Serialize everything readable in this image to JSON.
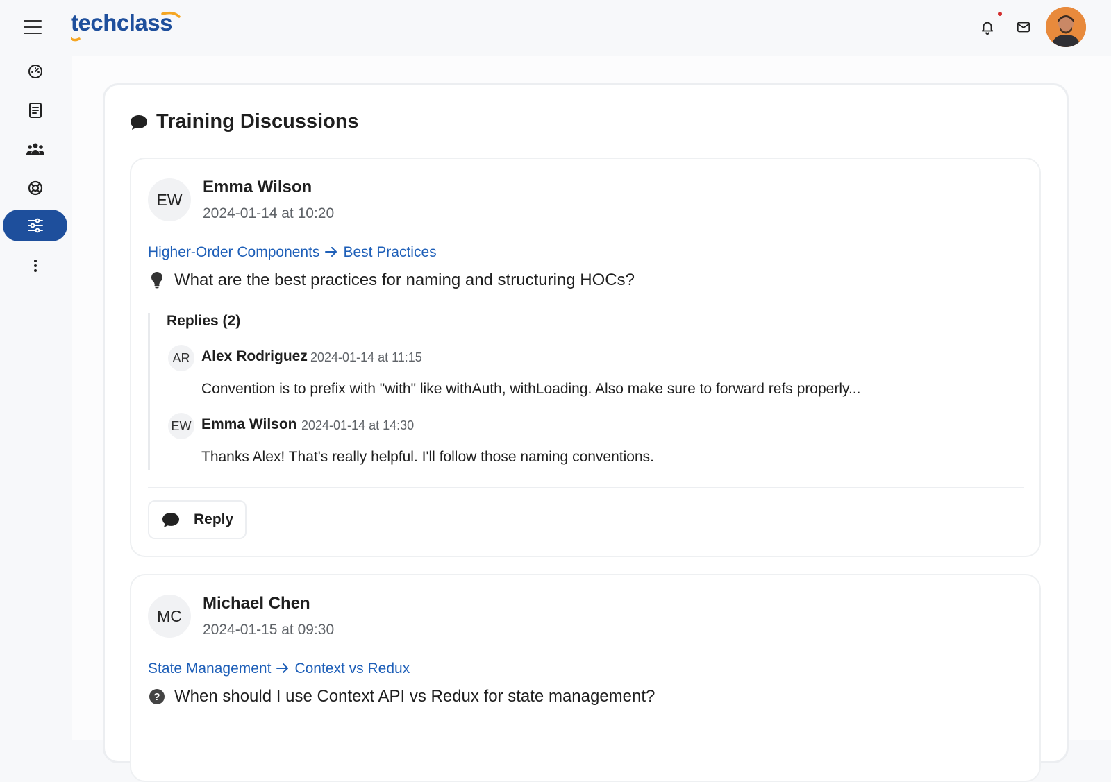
{
  "app": {
    "logo_text": "techclass"
  },
  "header": {
    "menu_icon": "hamburger-icon",
    "notification_icon": "bell-icon",
    "mail_icon": "mail-icon",
    "has_unread_notifications": true,
    "accent": "#1e4f9c",
    "logo_swoosh_color": "#f5a623"
  },
  "sidebar": {
    "items": [
      {
        "icon": "dashboard-icon",
        "active": false
      },
      {
        "icon": "book-icon",
        "active": false
      },
      {
        "icon": "users-icon",
        "active": false
      },
      {
        "icon": "support-icon",
        "active": false
      },
      {
        "icon": "sliders-icon",
        "active": true
      },
      {
        "icon": "more-vertical-icon",
        "active": false
      }
    ]
  },
  "page": {
    "title": "Training Discussions",
    "title_icon": "chat-bubble-icon"
  },
  "threads": [
    {
      "initials": "EW",
      "author": "Emma Wilson",
      "timestamp": "2024-01-14 at 10:20",
      "topic": "Higher-Order Components",
      "subtopic": "Best Practices",
      "question_icon": "lightbulb-icon",
      "question": "What are the best practices for naming and structuring HOCs?",
      "replies_label": "Replies (2)",
      "replies": [
        {
          "initials": "AR",
          "author": "Alex Rodriguez",
          "timestamp": "2024-01-14 at 11:15",
          "text": "Convention is to prefix with \"with\" like withAuth, withLoading. Also make sure to forward refs properly..."
        },
        {
          "initials": "EW",
          "author": "Emma Wilson",
          "timestamp": "2024-01-14 at 14:30",
          "text": "Thanks Alex! That's really helpful. I'll follow those naming conventions."
        }
      ],
      "reply_button": "Reply"
    },
    {
      "initials": "MC",
      "author": "Michael Chen",
      "timestamp": "2024-01-15 at 09:30",
      "topic": "State Management",
      "subtopic": "Context vs Redux",
      "question_icon": "help-circle-icon",
      "question": "When should I use Context API vs Redux for state management?"
    }
  ]
}
